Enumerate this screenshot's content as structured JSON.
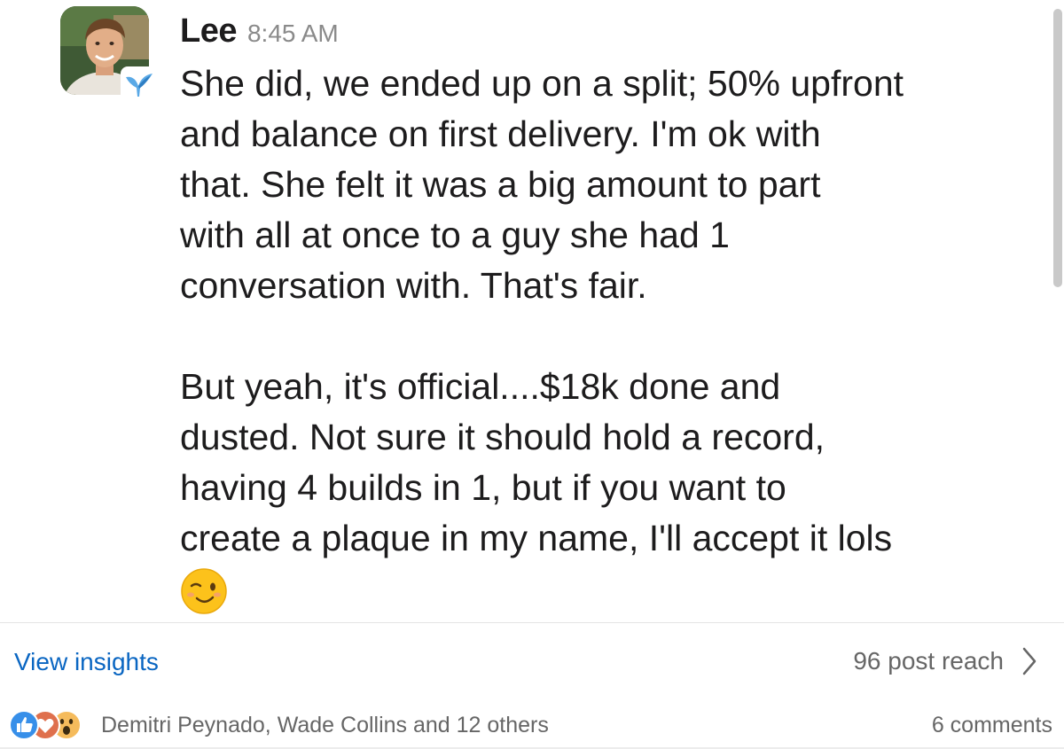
{
  "message": {
    "sender_name": "Lee",
    "timestamp": "8:45 AM",
    "avatar_icon": "user-avatar-photo",
    "badge_icon": "bird-badge-icon",
    "paragraphs": [
      "She did, we ended up on a split; 50% upfront\nand balance on first delivery. I'm ok with\nthat. She felt it was a big amount to part\nwith all at once to a guy she had 1\nconversation with. That's fair.",
      "But yeah, it's official....$18k done and\ndusted. Not sure it should hold a record,\nhaving 4 builds in 1, but if you want to\ncreate a plaque in my name, I'll accept it lols"
    ],
    "emoji_icon": "winking-face-emoji"
  },
  "insights": {
    "view_insights_label": "View insights",
    "post_reach_label": "96 post reach",
    "chevron_icon": "chevron-right-icon"
  },
  "social": {
    "reaction_icons": [
      "like-icon",
      "love-icon",
      "wow-icon"
    ],
    "reactors_label": "Demitri Peynado, Wade Collins and 12 others",
    "comments_label": "6 comments"
  },
  "colors": {
    "link_blue": "#0a66c2",
    "like_blue": "#378fe9",
    "love_red": "#df704d",
    "wow_yellow": "#f5bb5c",
    "text_primary": "#1d1c1d",
    "text_secondary": "#666666"
  }
}
